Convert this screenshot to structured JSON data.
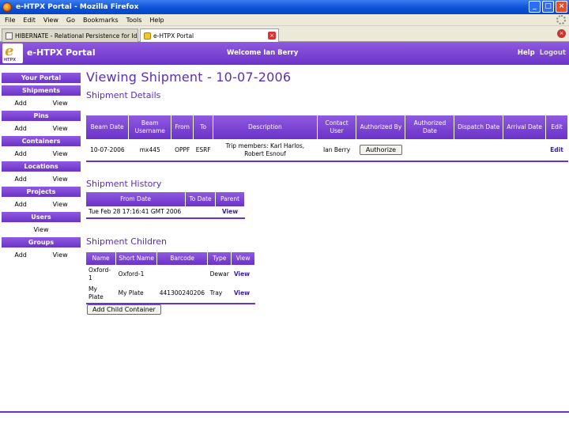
{
  "window": {
    "title": "e-HTPX Portal - Mozilla Firefox",
    "min_glyph": "_",
    "max_glyph": "□",
    "close_glyph": "×"
  },
  "menu": [
    "File",
    "Edit",
    "View",
    "Go",
    "Bookmarks",
    "Tools",
    "Help"
  ],
  "tabs": [
    {
      "label": "HIBERNATE - Relational Persistence for Idio..."
    },
    {
      "label": "e-HTPX Portal"
    }
  ],
  "header": {
    "title": "e-HTPX Portal",
    "welcome": "Welcome Ian Berry",
    "help": "Help",
    "logout": "Logout",
    "logo_letter": "e",
    "logo_text": "HTPX"
  },
  "sidebar": {
    "your_portal": "Your Portal",
    "sections": [
      {
        "title": "Shipments",
        "links": [
          "Add",
          "View"
        ]
      },
      {
        "title": "Pins",
        "links": [
          "Add",
          "View"
        ]
      },
      {
        "title": "Containers",
        "links": [
          "Add",
          "View"
        ]
      },
      {
        "title": "Locations",
        "links": [
          "Add",
          "View"
        ]
      },
      {
        "title": "Projects",
        "links": [
          "Add",
          "View"
        ]
      },
      {
        "title": "Users",
        "links": [
          "View"
        ]
      },
      {
        "title": "Groups",
        "links": [
          "Add",
          "View"
        ]
      }
    ]
  },
  "main": {
    "page_title": "Viewing Shipment - 10-07-2006",
    "details_title": "Shipment Details",
    "details_headers": [
      "Beam Date",
      "Beam Username",
      "From",
      "To",
      "Description",
      "Contact User",
      "Authorized By",
      "Authorized Date",
      "Dispatch Date",
      "Arrival Date",
      "Edit"
    ],
    "details_row": {
      "beam_date": "10-07-2006",
      "beam_username": "mx445",
      "from": "OPPF",
      "to": "ESRF",
      "description": "Trip members: Karl Harlos, Robert Esnouf",
      "contact_user": "Ian Berry",
      "authorize_label": "Authorize",
      "edit": "Edit"
    },
    "history_title": "Shipment History",
    "history_headers": [
      "From Date",
      "To Date",
      "Parent"
    ],
    "history_row": {
      "from_date": "Tue Feb 28 17:16:41 GMT 2006",
      "to_date": "",
      "parent": "View"
    },
    "children_title": "Shipment Children",
    "children_headers": [
      "Name",
      "Short Name",
      "Barcode",
      "Type",
      "View"
    ],
    "children_rows": [
      {
        "name": "Oxford-1",
        "short": "Oxford-1",
        "barcode": "",
        "type": "Dewar",
        "view": "View"
      },
      {
        "name": "My Plate",
        "short": "My Plate",
        "barcode": "441300240206",
        "type": "Tray",
        "view": "View"
      }
    ],
    "add_child_label": "Add Child Container"
  }
}
